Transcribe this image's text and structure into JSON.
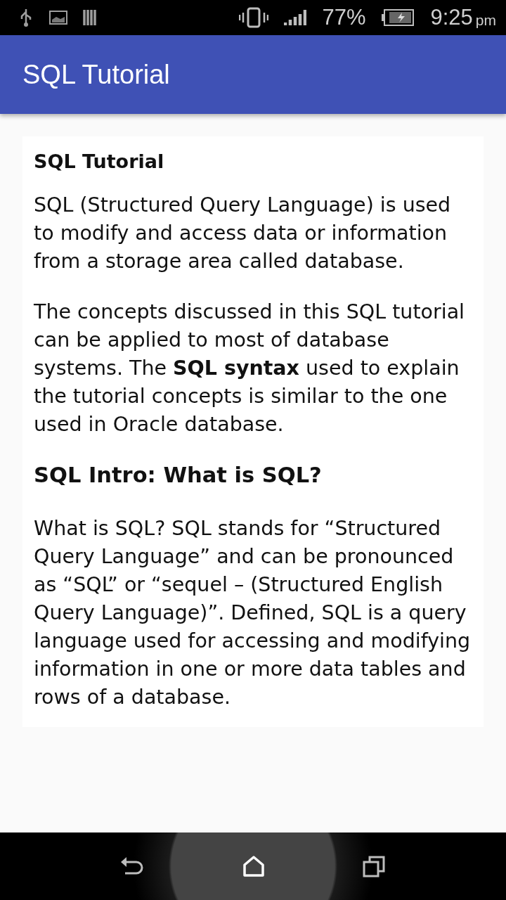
{
  "status_bar": {
    "battery": "77%",
    "time": "9:25",
    "time_suffix": "pm"
  },
  "app_bar": {
    "title": "SQL Tutorial"
  },
  "article": [
    {
      "kind": "title",
      "text": "SQL Tutorial"
    },
    {
      "kind": "paragraph",
      "text": "SQL (Structured Query Language) is used to modify and access data or information from a storage area called database."
    },
    {
      "kind": "paragraph",
      "text": "The concepts discussed in this SQL tutorial can be applied to most of database systems. The **SQL syntax** used to explain the tutorial concepts is similar to the one used in Oracle database."
    },
    {
      "kind": "heading",
      "text": "SQL Intro: What is SQL?"
    },
    {
      "kind": "paragraph",
      "text": "What is SQL? SQL stands for “Structured Query Language” and can be pronounced as “SQL” or “sequel – (Structured English Query Language)”. Defined, SQL is a query language used for accessing and modifying information in one or more data tables and rows of a database."
    }
  ]
}
